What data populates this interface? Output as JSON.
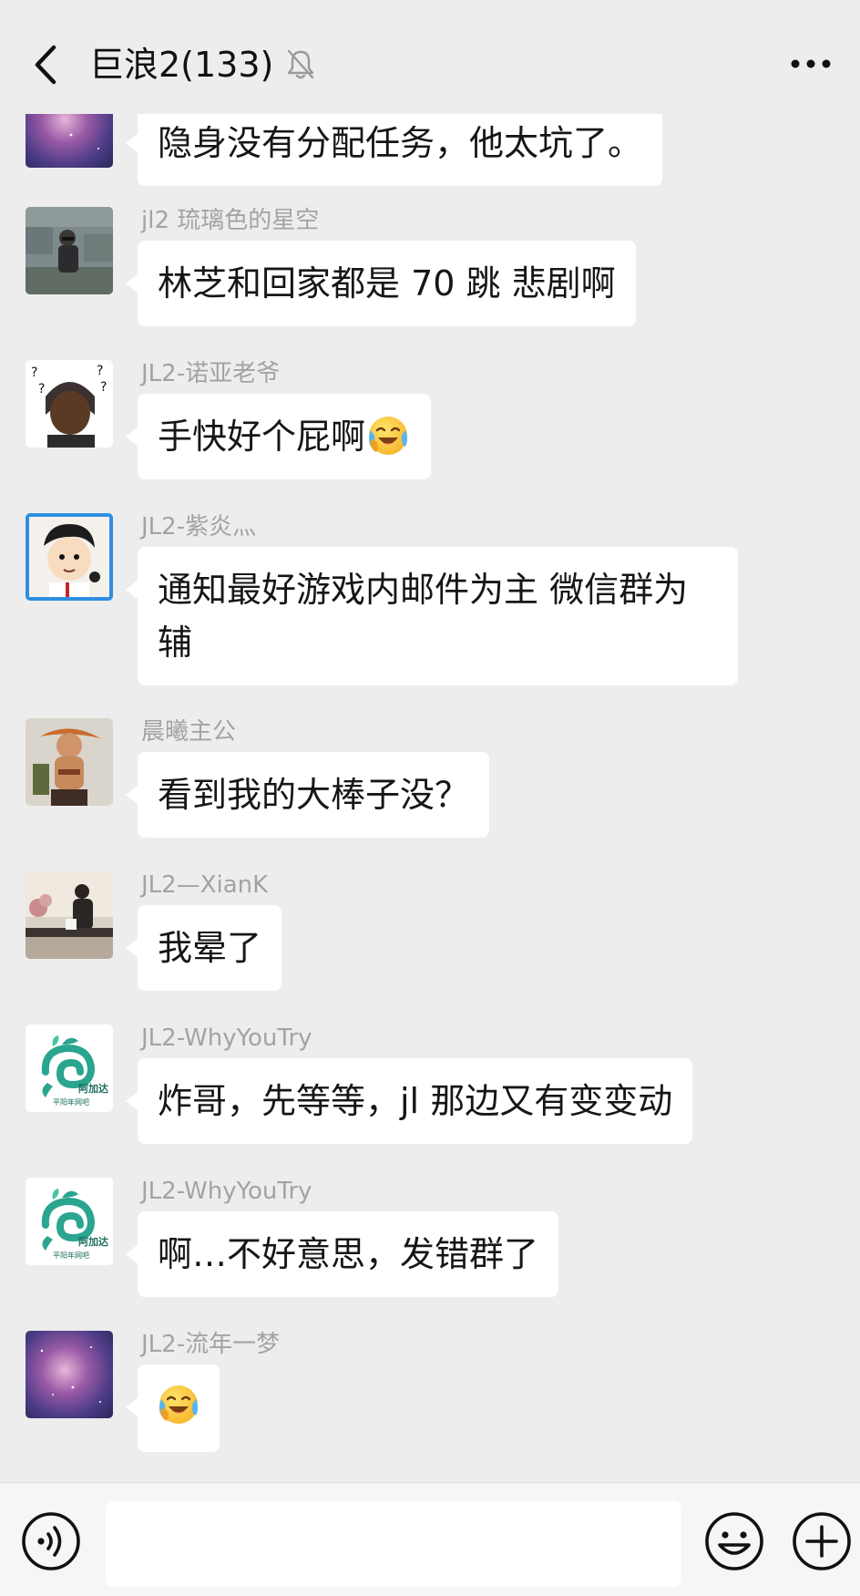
{
  "header": {
    "title": "巨浪2(133)",
    "back_icon": "chevron-left-icon",
    "mute_icon": "bell-off-icon",
    "more_icon": "more-horizontal-icon"
  },
  "messages": [
    {
      "sender": "",
      "text": "隐身没有分配任务，他太坑了。",
      "avatar": "galaxy-avatar"
    },
    {
      "sender": "jl2 琉璃色的星空",
      "text": "林芝和回家都是 70 跳 悲剧啊",
      "avatar": "stone-wall-person-avatar"
    },
    {
      "sender": "JL2-诺亚老爷",
      "text": "手快好个屁啊",
      "emoji": "face-with-tears-of-joy",
      "avatar": "question-marks-man-avatar"
    },
    {
      "sender": "JL2-紫炎灬",
      "text_line1": "通知最好游戏内邮件为主 微信群为",
      "text_line2": "辅",
      "avatar": "cartoon-boy-avatar"
    },
    {
      "sender": "晨曦主公",
      "text": "看到我的大棒子没？",
      "avatar": "pirate-figure-avatar"
    },
    {
      "sender": "JL2—XianK",
      "text": "我晕了",
      "avatar": "man-at-table-avatar"
    },
    {
      "sender": "JL2-WhyYouTry",
      "text": "炸哥，先等等，jl 那边又有变变动",
      "avatar": "green-logo-avatar",
      "logo_text": "阿加达",
      "logo_subtext": "平阳年网吧"
    },
    {
      "sender": "JL2-WhyYouTry",
      "text": "啊…不好意思，发错群了",
      "avatar": "green-logo-avatar",
      "logo_text": "阿加达",
      "logo_subtext": "平阳年网吧"
    },
    {
      "sender": "JL2-流年一梦",
      "emoji": "face-with-tears-of-joy",
      "avatar": "galaxy-avatar"
    }
  ],
  "input_bar": {
    "voice_icon": "voice-icon",
    "emoji_icon": "emoji-icon",
    "plus_icon": "plus-circle-icon",
    "input_value": ""
  },
  "colors": {
    "background": "#ededed",
    "bubble": "#ffffff",
    "sender_name": "#a3a3a3",
    "text": "#161616"
  }
}
